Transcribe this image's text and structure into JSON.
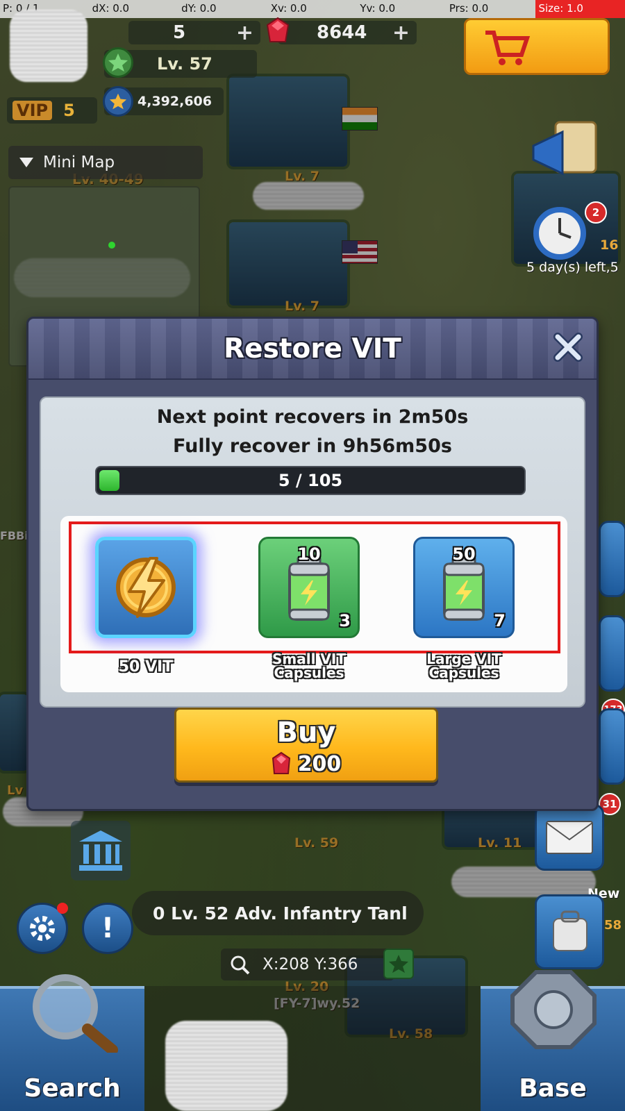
{
  "debug_bar": {
    "p": "P: 0 / 1",
    "dx": "dX: 0.0",
    "dy": "dY: 0.0",
    "xv": "Xv: 0.0",
    "yv": "Yv: 0.0",
    "prs": "Prs: 0.0",
    "size": "Size: 1.0"
  },
  "hud": {
    "vit_count": "5",
    "gems": "8644",
    "level": "Lv. 57",
    "power": "4,392,606",
    "vip_label": "VIP",
    "vip_level": "5",
    "minimap_label": "Mini Map",
    "map_level_range": "Lv. 40-49"
  },
  "right_side": {
    "badge_event": "2",
    "badge_timer": "16",
    "event_time": "5 day(s) left,5",
    "badge_173": "173",
    "badge_31": "31",
    "new_label": "New",
    "badge_58": "58"
  },
  "map": {
    "base_labels": [
      "Lv. 7",
      "Lv. 7",
      "Lv. 59",
      "Lv. 11",
      "Lv. 58",
      "Lv. 20"
    ],
    "player_tag": "[FY-7]wy.52",
    "side_tag": "FBBi",
    "side_level": "Lv"
  },
  "ticker": {
    "text": "0 Lv. 52 Adv. Infantry Tanl"
  },
  "coords": {
    "text": "X:208 Y:366"
  },
  "bottom_bar": {
    "search_label": "Search",
    "base_label": "Base"
  },
  "dialog": {
    "title": "Restore VIT",
    "next_point": "Next point recovers in 2m50s",
    "full_recover": "Fully recover in 9h56m50s",
    "vit_current": 5,
    "vit_max": 105,
    "vit_text": "5 / 105",
    "items": [
      {
        "label": "50 VIT",
        "amount": "",
        "count": "",
        "icon": "lightning-icon",
        "selected": true
      },
      {
        "label": "Small VIT Capsules",
        "label_line1": "Small VIT",
        "label_line2": "Capsules",
        "amount": "10",
        "count": "3",
        "icon": "battery-capsule-icon",
        "selected": false
      },
      {
        "label": "Large VIT Capsules",
        "label_line1": "Large VIT",
        "label_line2": "Capsules",
        "amount": "50",
        "count": "7",
        "icon": "battery-capsule-icon",
        "selected": false
      }
    ],
    "buy_label": "Buy",
    "buy_price": "200",
    "price_icon": "ruby-gem-icon"
  },
  "colors": {
    "highlight": "#e41a1a",
    "buy_button": "#ffb81c",
    "progress_fill": "#2db52d",
    "dialog_bg": "#474d6b"
  }
}
